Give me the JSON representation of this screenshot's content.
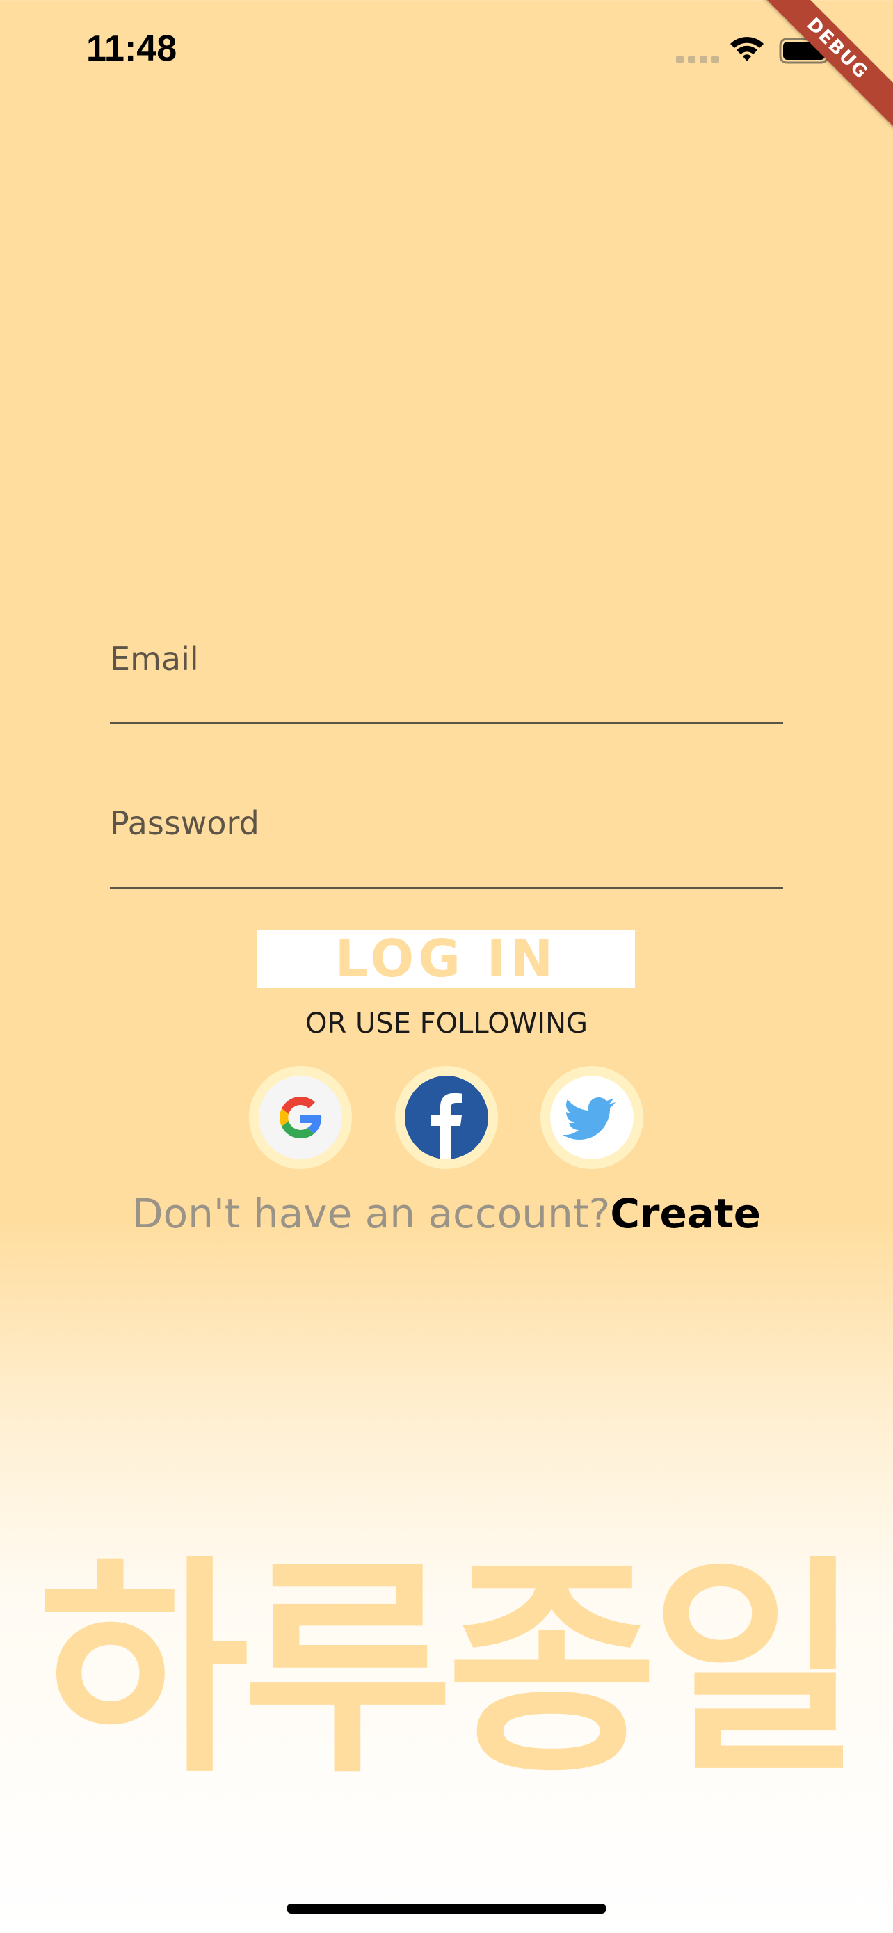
{
  "status_bar": {
    "time": "11:48",
    "icons": [
      "cellular-signal-icon",
      "wifi-icon",
      "battery-icon"
    ]
  },
  "debug_banner": "DEBUG",
  "form": {
    "email_label": "Email",
    "password_label": "Password",
    "login_label": "LOG IN",
    "or_text": "OR USE FOLLOWING"
  },
  "social": [
    {
      "name": "google",
      "icon": "google-icon"
    },
    {
      "name": "facebook",
      "icon": "facebook-icon"
    },
    {
      "name": "twitter",
      "icon": "twitter-icon"
    }
  ],
  "signup": {
    "prompt": "Don't have an account?",
    "link": "Create"
  },
  "brand": "하루종일",
  "colors": {
    "background": "#ffdd9e",
    "accent": "#ffdd9e",
    "text_muted": "#9a9388",
    "social_ring": "#fff1c2",
    "debug_ribbon": "#b34532"
  }
}
